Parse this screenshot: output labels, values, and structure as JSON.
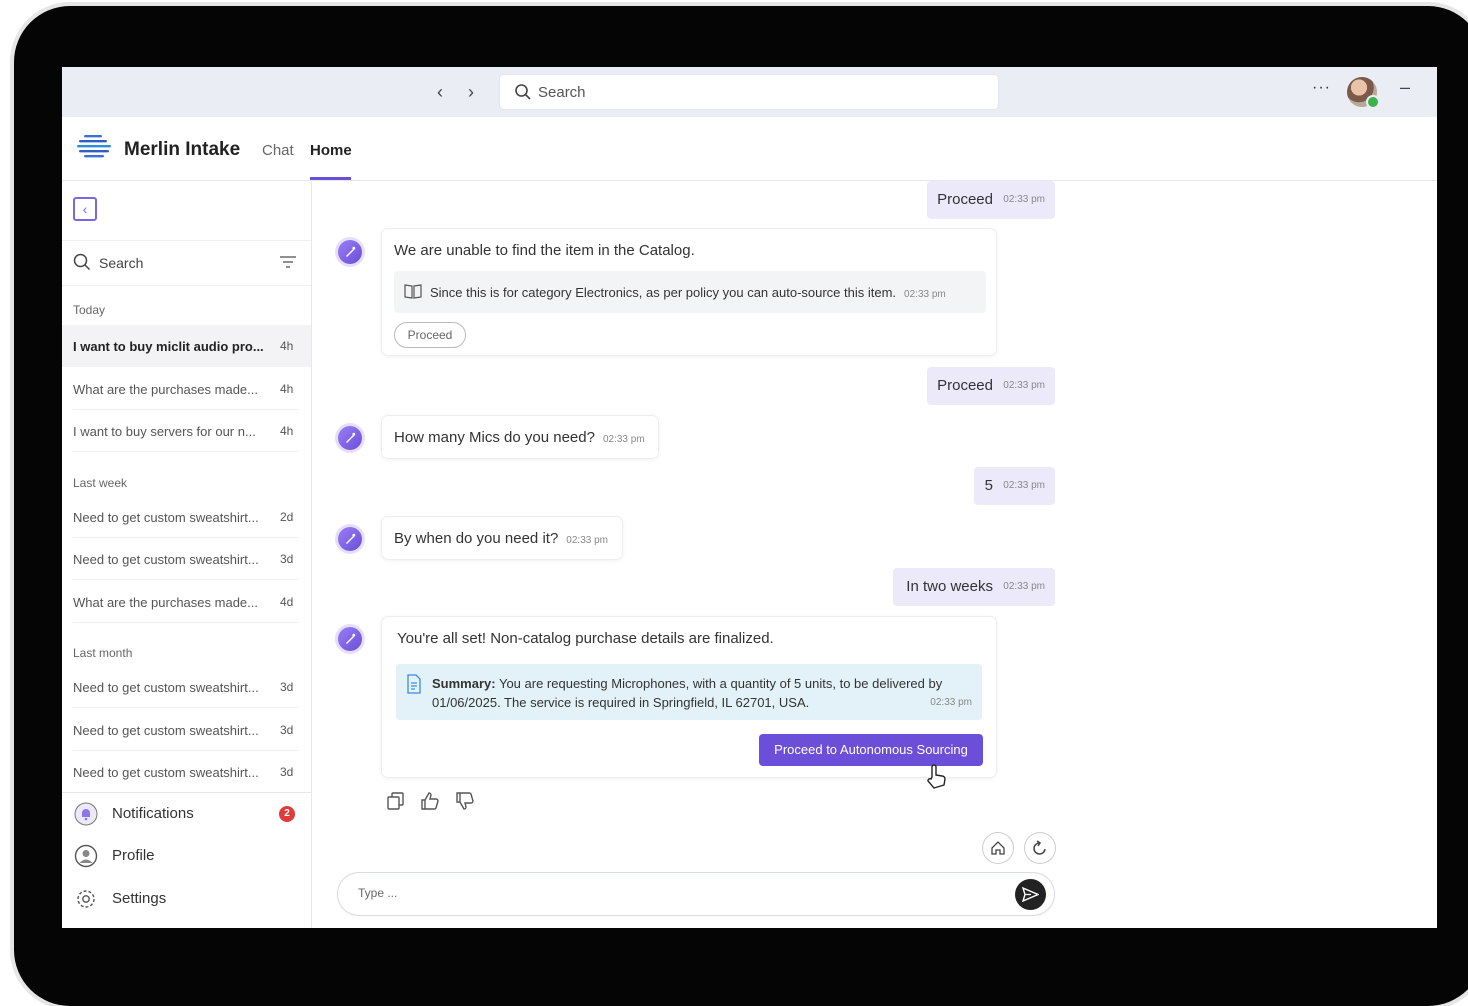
{
  "window": {
    "search_placeholder": "Search",
    "more_label": "···",
    "minimize_label": "–"
  },
  "app": {
    "title": "Merlin Intake",
    "tabs": [
      {
        "label": "Chat",
        "active": false
      },
      {
        "label": "Home",
        "active": true
      }
    ]
  },
  "sidebar": {
    "search_placeholder": "Search",
    "groups": [
      {
        "label": "Today",
        "items": [
          {
            "title": "I want to buy miclit audio pro...",
            "age": "4h",
            "active": true
          },
          {
            "title": "What are the purchases made...",
            "age": "4h"
          },
          {
            "title": "I want to buy servers for our n...",
            "age": "4h"
          }
        ]
      },
      {
        "label": "Last week",
        "items": [
          {
            "title": "Need to get custom sweatshirt...",
            "age": "2d"
          },
          {
            "title": "Need to get custom sweatshirt...",
            "age": "3d"
          },
          {
            "title": "What are the purchases made...",
            "age": "4d"
          }
        ]
      },
      {
        "label": "Last month",
        "items": [
          {
            "title": "Need to get custom sweatshirt...",
            "age": "3d"
          },
          {
            "title": "Need to get custom sweatshirt...",
            "age": "3d"
          },
          {
            "title": "Need to get custom sweatshirt...",
            "age": "3d"
          }
        ]
      }
    ],
    "bottom": {
      "notifications": {
        "label": "Notifications",
        "count": "2"
      },
      "profile": {
        "label": "Profile"
      },
      "settings": {
        "label": "Settings"
      }
    }
  },
  "chat": {
    "messages": [
      {
        "from": "user",
        "text": "Proceed",
        "time": "02:33 pm"
      },
      {
        "from": "bot",
        "text": "We are unable to find the item in the Catalog.",
        "info": "Since this is for category Electronics, as per policy you can auto-source this item.",
        "time": "02:33 pm",
        "action": "Proceed"
      },
      {
        "from": "user",
        "text": "Proceed",
        "time": "02:33 pm"
      },
      {
        "from": "bot",
        "text": "How many Mics do you need?",
        "time": "02:33 pm"
      },
      {
        "from": "user",
        "text": "5",
        "time": "02:33 pm"
      },
      {
        "from": "bot",
        "text": "By when do you need it?",
        "time": "02:33 pm"
      },
      {
        "from": "user",
        "text": "In two weeks",
        "time": "02:33 pm"
      },
      {
        "from": "bot",
        "text": "You're all set! Non-catalog purchase details are finalized.",
        "summary_label": "Summary:",
        "summary_line1": "You are requesting Microphones, with a quantity of 5 units, to be delivered by",
        "summary_line2": "01/06/2025. The service is required in Springfield, IL 62701, USA.",
        "time": "02:33 pm",
        "action": "Proceed to Autonomous Sourcing"
      }
    ],
    "compose_placeholder": "Type ..."
  },
  "colors": {
    "accent": "#6c4fd8",
    "user_bubble": "#ece9fb",
    "summary_bg": "#e3f2f8",
    "badge": "#e03b3b"
  }
}
